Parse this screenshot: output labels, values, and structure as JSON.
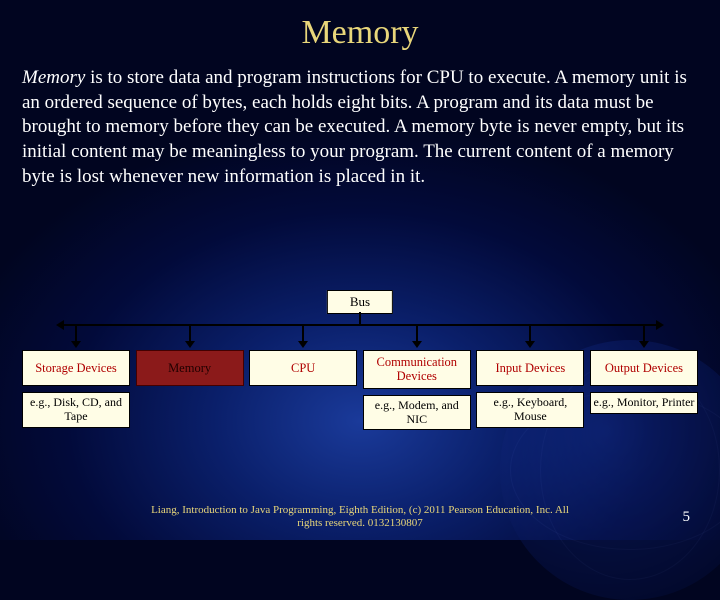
{
  "title": "Memory",
  "lead_word": "Memory",
  "body_rest": " is to store data and program instructions for CPU to execute. A memory unit is an ordered sequence of bytes, each holds eight bits. A program and its data must be brought to memory before they can be executed. A memory byte is never empty, but its initial content may be meaningless to your program. The current content of a memory byte is lost whenever new information is placed in it.",
  "diagram": {
    "bus_label": "Bus",
    "components": [
      {
        "label": "Storage Devices",
        "example": "e.g., Disk, CD, and Tape",
        "highlight": false
      },
      {
        "label": "Memory",
        "example": "",
        "highlight": true
      },
      {
        "label": "CPU",
        "example": "",
        "highlight": false
      },
      {
        "label": "Communication Devices",
        "example": "e.g., Modem, and NIC",
        "highlight": false
      },
      {
        "label": "Input Devices",
        "example": "e.g., Keyboard, Mouse",
        "highlight": false
      },
      {
        "label": "Output Devices",
        "example": "e.g., Monitor, Printer",
        "highlight": false
      }
    ]
  },
  "footer": "Liang, Introduction to Java Programming, Eighth Edition, (c) 2011 Pearson Education, Inc. All rights reserved. 0132130807",
  "page_number": "5"
}
